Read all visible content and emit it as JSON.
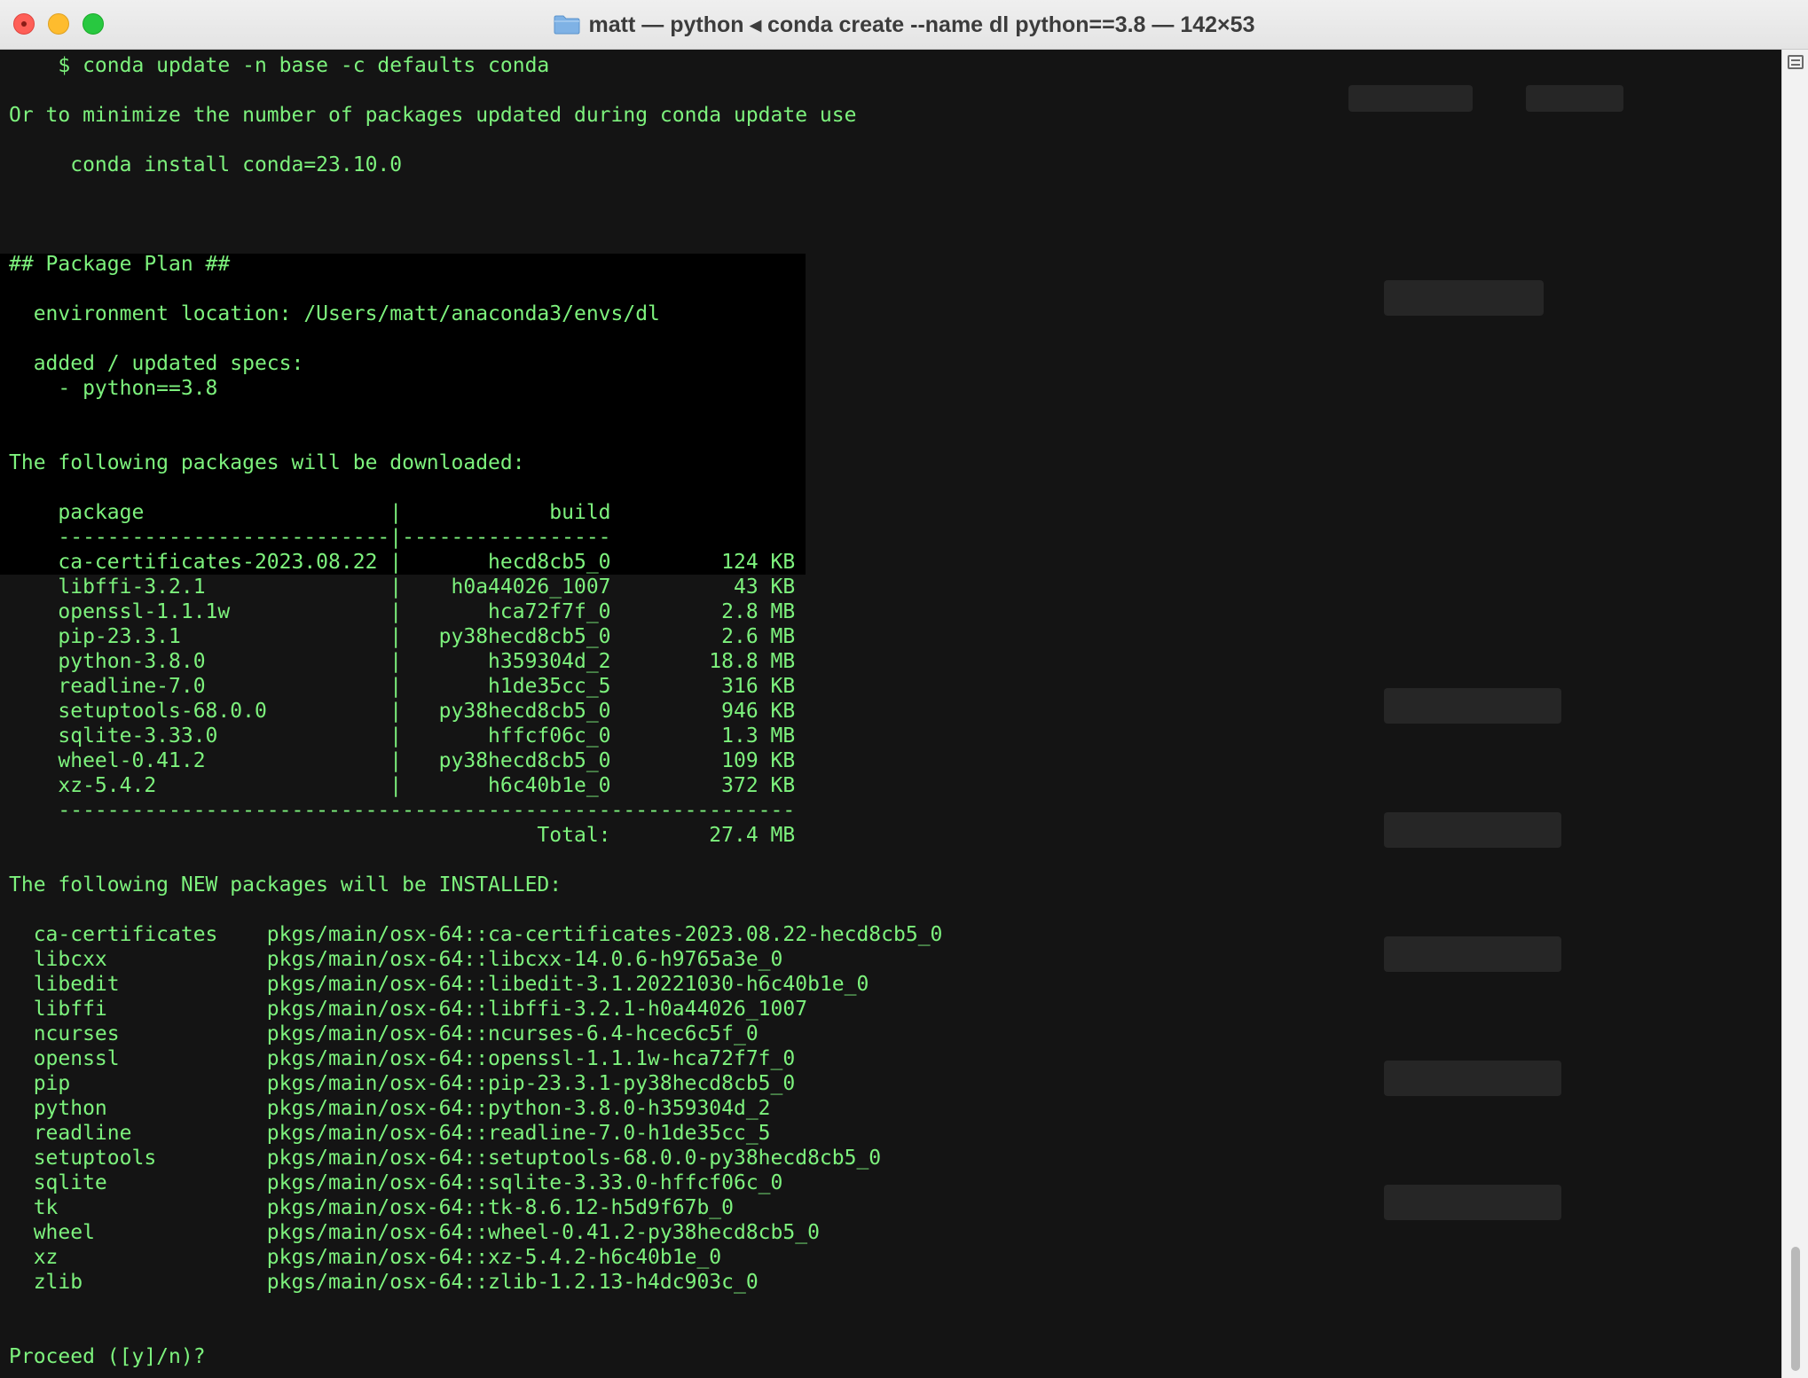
{
  "window": {
    "title": "matt — python ◂ conda create --name dl python==3.8 — 142×53"
  },
  "terminal": {
    "lines": [
      "    $ conda update -n base -c defaults conda",
      "",
      "Or to minimize the number of packages updated during conda update use",
      "",
      "     conda install conda=23.10.0",
      "",
      "",
      "",
      "## Package Plan ##",
      "",
      "  environment location: /Users/matt/anaconda3/envs/dl",
      "",
      "  added / updated specs:",
      "    - python==3.8",
      "",
      "",
      "The following packages will be downloaded:",
      "",
      "    package                    |            build",
      "    ---------------------------|-----------------",
      "    ca-certificates-2023.08.22 |       hecd8cb5_0         124 KB",
      "    libffi-3.2.1               |    h0a44026_1007          43 KB",
      "    openssl-1.1.1w             |       hca72f7f_0         2.8 MB",
      "    pip-23.3.1                 |   py38hecd8cb5_0         2.6 MB",
      "    python-3.8.0               |       h359304d_2        18.8 MB",
      "    readline-7.0               |       h1de35cc_5         316 KB",
      "    setuptools-68.0.0          |   py38hecd8cb5_0         946 KB",
      "    sqlite-3.33.0              |       hffcf06c_0         1.3 MB",
      "    wheel-0.41.2               |   py38hecd8cb5_0         109 KB",
      "    xz-5.4.2                   |       h6c40b1e_0         372 KB",
      "    ------------------------------------------------------------",
      "                                           Total:        27.4 MB",
      "",
      "The following NEW packages will be INSTALLED:",
      "",
      "  ca-certificates    pkgs/main/osx-64::ca-certificates-2023.08.22-hecd8cb5_0",
      "  libcxx             pkgs/main/osx-64::libcxx-14.0.6-h9765a3e_0",
      "  libedit            pkgs/main/osx-64::libedit-3.1.20221030-h6c40b1e_0",
      "  libffi             pkgs/main/osx-64::libffi-3.2.1-h0a44026_1007",
      "  ncurses            pkgs/main/osx-64::ncurses-6.4-hcec6c5f_0",
      "  openssl            pkgs/main/osx-64::openssl-1.1.1w-hca72f7f_0",
      "  pip                pkgs/main/osx-64::pip-23.3.1-py38hecd8cb5_0",
      "  python             pkgs/main/osx-64::python-3.8.0-h359304d_2",
      "  readline           pkgs/main/osx-64::readline-7.0-h1de35cc_5",
      "  setuptools         pkgs/main/osx-64::setuptools-68.0.0-py38hecd8cb5_0",
      "  sqlite             pkgs/main/osx-64::sqlite-3.33.0-hffcf06c_0",
      "  tk                 pkgs/main/osx-64::tk-8.6.12-h5d9f67b_0",
      "  wheel              pkgs/main/osx-64::wheel-0.41.2-py38hecd8cb5_0",
      "  xz                 pkgs/main/osx-64::xz-5.4.2-h6c40b1e_0",
      "  zlib               pkgs/main/osx-64::zlib-1.2.13-h4dc903c_0",
      "",
      "",
      "Proceed ([y]/n)?"
    ]
  },
  "colors": {
    "text": "#7df27d",
    "background": "#141414"
  },
  "icons": {
    "close": "close-icon",
    "minimize": "minimize-icon",
    "zoom": "zoom-icon",
    "folder": "folder-icon",
    "scroll_marks": "marks-icon"
  }
}
